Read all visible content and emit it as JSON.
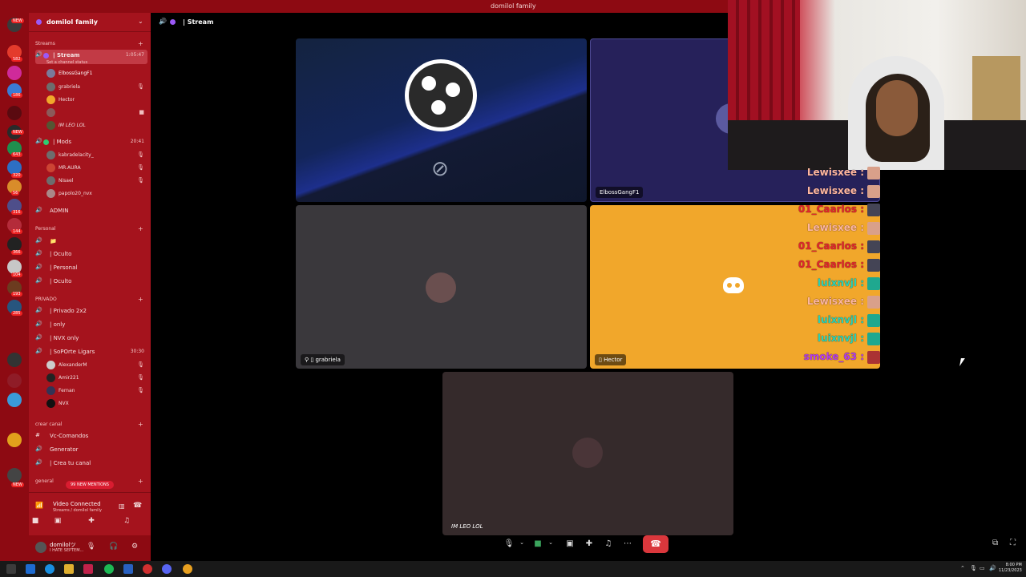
{
  "window": {
    "title": "domilol family"
  },
  "server_rail": {
    "badges": [
      "NEW",
      "582",
      "186",
      "NEW",
      "643",
      "320",
      "56",
      "316",
      "144",
      "366",
      "104",
      "193",
      "285",
      "NEW"
    ]
  },
  "server": {
    "name": "domilol family"
  },
  "categories": {
    "streams": "Streams",
    "personal": "Personal",
    "privado": "PRIVADO",
    "crear": "crear canal",
    "general": "general"
  },
  "channels": {
    "stream": {
      "label": "| Stream",
      "time": "1:05:47",
      "status": "Set a channel status"
    },
    "mods": {
      "label": "| Mods",
      "time": "20:41"
    },
    "admin": {
      "label": "ADMIN"
    },
    "oculto1": {
      "label": "| Oculto"
    },
    "personal": {
      "label": "| Personal"
    },
    "oculto2": {
      "label": "| Oculto"
    },
    "privado": {
      "label": "| Privado 2x2"
    },
    "only": {
      "label": "| only"
    },
    "nvx": {
      "label": "| NVX only"
    },
    "soporte": {
      "label": "| SoPOrte Ligars",
      "time": "30:30"
    },
    "vc": {
      "label": "Vc-Comandos"
    },
    "generator": {
      "label": "Generator"
    },
    "crea": {
      "label": "| Crea tu canal"
    }
  },
  "stream_users": [
    "ElbossGangF1",
    "grabriela",
    "Hector",
    "",
    "IM LEO LOL"
  ],
  "mods_users": [
    "kabradelacity_",
    "MR.AURA",
    "Nisael",
    "papolo20_nvx"
  ],
  "soporte_users": [
    "AlexanderM",
    "Amir221",
    "Fernan",
    "NVX"
  ],
  "mentions": "99 NEW MENTIONS",
  "voice": {
    "title": "Video Connected",
    "sub": "Streams / domilol family"
  },
  "user_panel": {
    "name": "domilolツ",
    "status": "I HATE SEPTEM..."
  },
  "call": {
    "channel": "| Stream"
  },
  "tiles": {
    "elboss": "ElbossGangF1",
    "grabriela": "grabriela",
    "hector": "Hector",
    "leo": "IM LEO LOL"
  },
  "chat": [
    {
      "user": "Lewisxee :",
      "color": "#ffb7a0"
    },
    {
      "user": "Lewisxee :",
      "color": "#ffb7a0"
    },
    {
      "user": "01_Caarlos :",
      "color": "#e3232d"
    },
    {
      "user": "Lewisxee :",
      "color": "#ffb7a0"
    },
    {
      "user": "01_Caarlos :",
      "color": "#e3232d"
    },
    {
      "user": "01_Caarlos :",
      "color": "#e3232d"
    },
    {
      "user": "luixnvjl :",
      "color": "#2ad3b8"
    },
    {
      "user": "Lewisxee :",
      "color": "#ffb7a0"
    },
    {
      "user": "luixnvjl :",
      "color": "#2ad3b8"
    },
    {
      "user": "luixnvjl :",
      "color": "#2ad3b8"
    },
    {
      "user": "smoke_63 :",
      "color": "#b43cf0"
    }
  ],
  "clock": {
    "time": "8:00 PM",
    "date": "11/23/2023"
  }
}
